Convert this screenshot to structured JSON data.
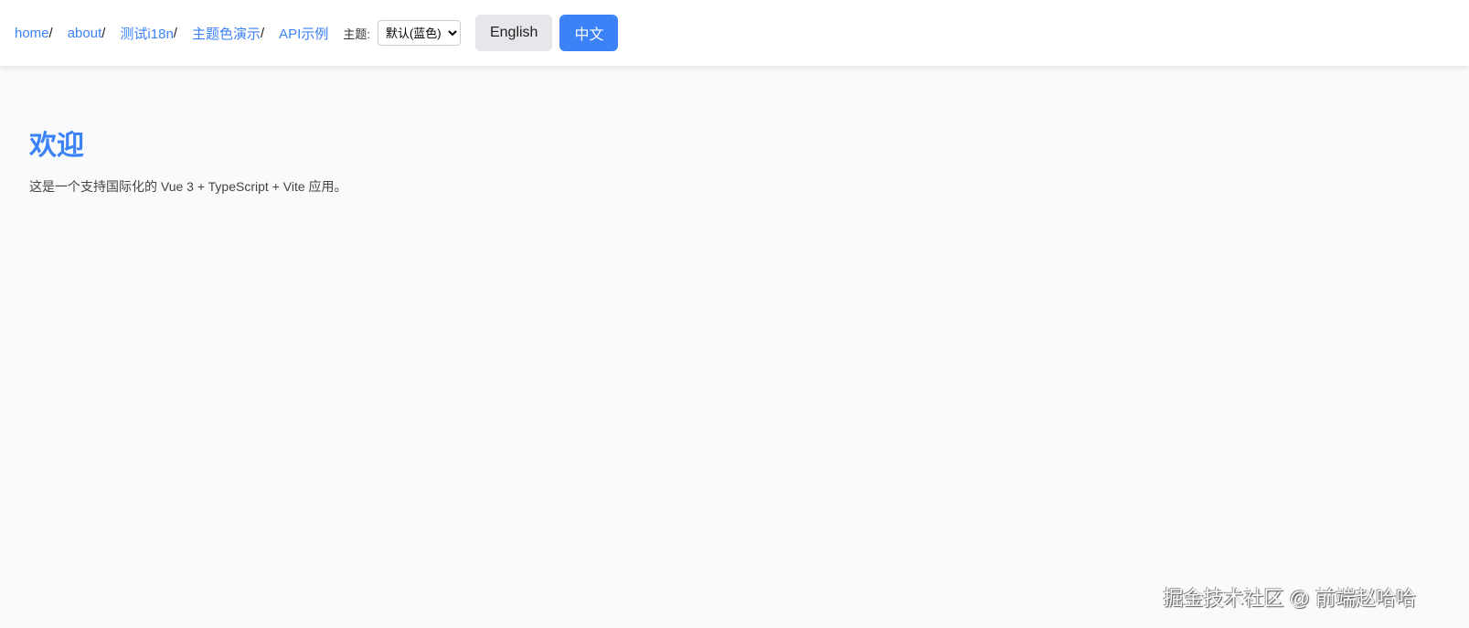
{
  "nav": {
    "links": [
      "home",
      "about",
      "测试i18n",
      "主题色演示",
      "API示例"
    ],
    "separator": "/",
    "theme_label": "主题:",
    "theme_selected": "默认(蓝色)",
    "btn_en": "English",
    "btn_zh": "中文"
  },
  "main": {
    "title": "欢迎",
    "description": "这是一个支持国际化的 Vue 3 + TypeScript + Vite 应用。"
  },
  "watermark": "掘金技术社区 @ 前端赵哈哈",
  "colors": {
    "accent": "#3b82f6"
  }
}
